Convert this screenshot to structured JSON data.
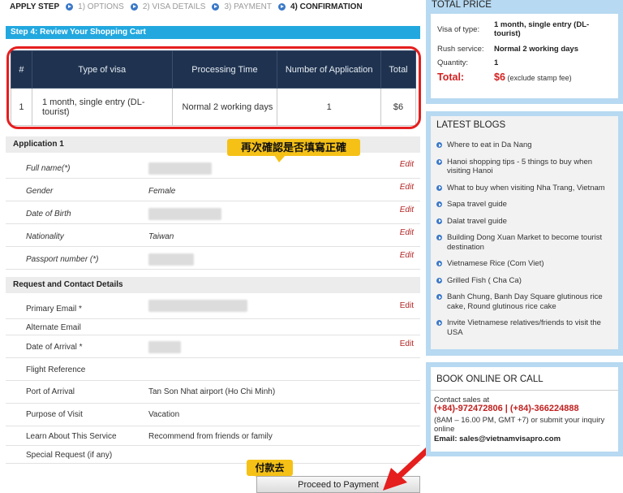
{
  "steps": [
    "APPLY STEP",
    "1) OPTIONS",
    "2) VISA DETAILS",
    "3) PAYMENT",
    "4) CONFIRMATION"
  ],
  "step_header": "Step 4: Review Your Shopping Cart",
  "cart": {
    "headers": [
      "#",
      "Type of visa",
      "Processing Time",
      "Number of Application",
      "Total"
    ],
    "row": [
      "1",
      "1 month, single entry (DL-tourist)",
      "Normal 2 working days",
      "1",
      "$6"
    ]
  },
  "callouts": {
    "review": "再次確認是否填寫正確",
    "pay": "付款去"
  },
  "application": {
    "title": "Application 1",
    "rows": [
      {
        "label": "Full name(*)",
        "value": "",
        "edit": "Edit"
      },
      {
        "label": "Gender",
        "value": "Female",
        "edit": "Edit"
      },
      {
        "label": "Date of Birth",
        "value": "",
        "edit": "Edit"
      },
      {
        "label": "Nationality",
        "value": "Taiwan",
        "edit": "Edit"
      },
      {
        "label": "Passport number (*)",
        "value": "",
        "edit": "Edit"
      }
    ]
  },
  "contact": {
    "title": "Request and Contact Details",
    "rows": [
      {
        "label": "Primary Email *",
        "value": "",
        "edit": "Edit"
      },
      {
        "label": "Alternate Email",
        "value": ""
      },
      {
        "label": "Date of Arrival *",
        "value": "",
        "edit": "Edit"
      },
      {
        "label": "Flight Reference",
        "value": ""
      },
      {
        "label": "Port of Arrival",
        "value": "Tan Son Nhat airport (Ho Chi Minh)"
      },
      {
        "label": "Purpose of Visit",
        "value": "Vacation"
      },
      {
        "label": "Learn About This Service",
        "value": "Recommend from friends or family"
      },
      {
        "label": "Special Request (if any)",
        "value": ""
      }
    ]
  },
  "proceed_label": "Proceed to Payment",
  "total_price": {
    "title": "TOTAL PRICE",
    "visa_type_label": "Visa of type:",
    "visa_type_value": "1 month, single entry (DL-tourist)",
    "rush_label": "Rush service:",
    "rush_value": "Normal 2 working days",
    "qty_label": "Quantity:",
    "qty_value": "1",
    "total_label": "Total:",
    "total_value": "$6",
    "total_note": "(exclude stamp fee)"
  },
  "blogs": {
    "title": "LATEST BLOGS",
    "items": [
      "Where to eat in Da Nang",
      "Hanoi shopping tips - 5 things to buy when visiting Hanoi",
      "What to buy when visiting Nha Trang, Vietnam",
      "Sapa travel guide",
      "Dalat travel guide",
      "Building Dong Xuan Market to become tourist destination",
      "Vietnamese Rice (Com Viet)",
      "Grilled Fish ( Cha Ca)",
      "Banh Chung, Banh Day Square glutinous rice cake, Round glutinous rice cake",
      "Invite Vietnamese relatives/friends to visit the USA"
    ]
  },
  "book": {
    "title": "BOOK ONLINE OR CALL",
    "contact_label": "Contact sales at",
    "phones": "(+84)-972472806 | (+84)-366224888",
    "hours": "(8AM – 16.00 PM, GMT +7) or submit your inquiry online",
    "email": "Email: sales@vietnamvisapro.com"
  },
  "colors": {
    "header_blue": "#22a8df",
    "table_navy": "#1f3350",
    "highlight_red": "#e51e1e",
    "callout_yellow": "#f5c116",
    "side_blue": "#b7d9f1"
  }
}
